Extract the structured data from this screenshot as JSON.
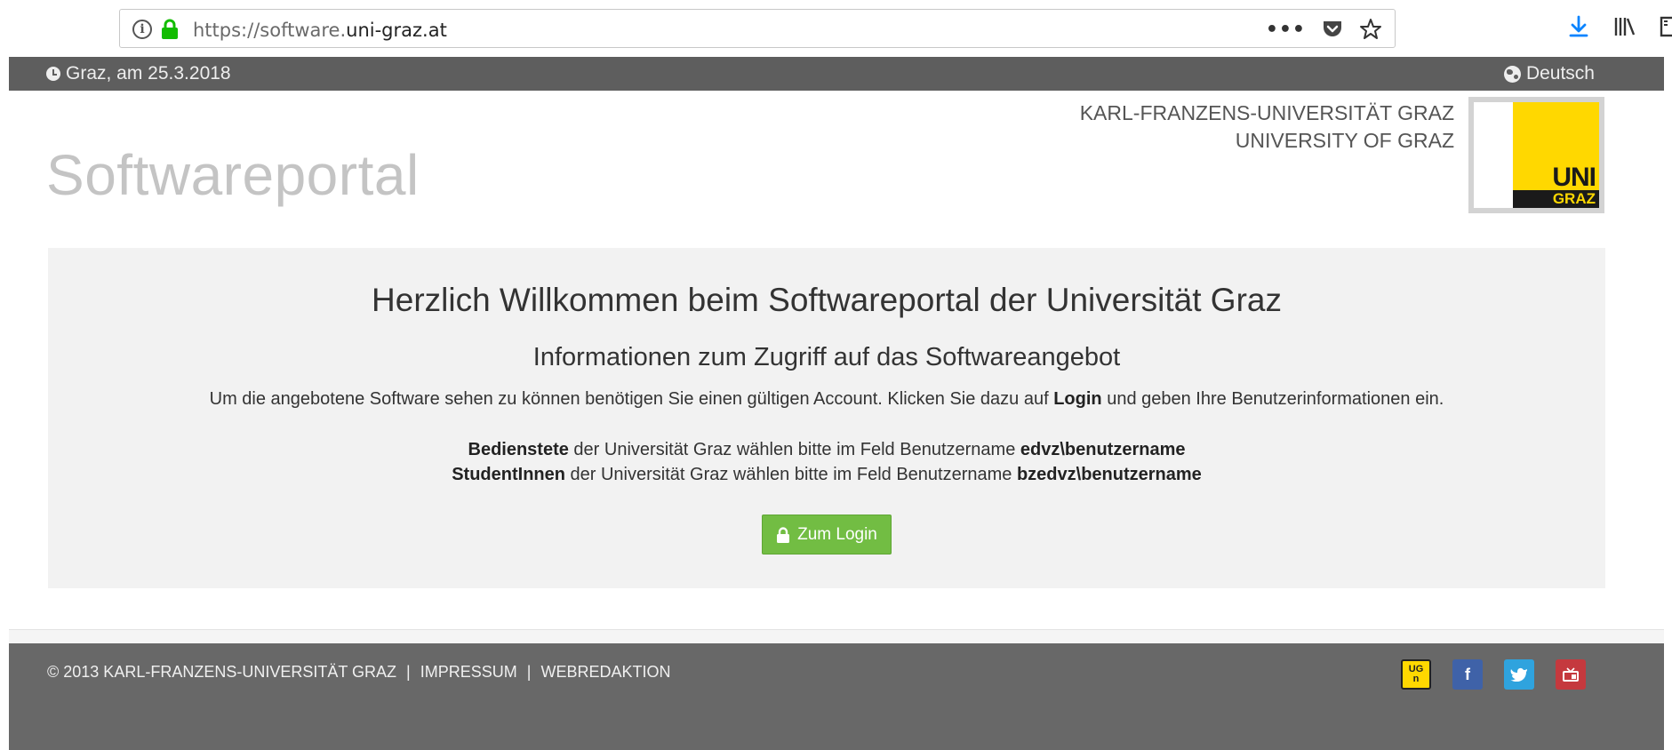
{
  "browser": {
    "url_prefix": "https://software.",
    "url_domain": "uni-graz.at",
    "page_actions_label": "•••"
  },
  "topbar": {
    "date": "Graz, am 25.3.2018",
    "language": "Deutsch"
  },
  "header": {
    "title": "Softwareportal",
    "uni_name_de": "KARL-FRANZENS-UNIVERSITÄT GRAZ",
    "uni_name_en": "UNIVERSITY OF GRAZ",
    "logo_top": "UNI",
    "logo_bottom": "GRAZ"
  },
  "main": {
    "heading": "Herzlich Willkommen beim Softwareportal der Universität Graz",
    "subheading": "Informationen zum Zugriff auf das Softwareangebot",
    "intro_before": "Um die angebotene Software sehen zu können benötigen Sie einen gültigen Account. Klicken Sie dazu auf ",
    "intro_bold": "Login",
    "intro_after": " und geben Ihre Benutzerinformationen ein.",
    "staff_bold": "Bedienstete",
    "staff_text": " der Universität Graz wählen bitte im Feld Benutzername ",
    "staff_user": "edvz\\benutzername",
    "student_bold": "StudentInnen",
    "student_text": " der Universität Graz wählen bitte im Feld Benutzername ",
    "student_user": "bzedvz\\benutzername",
    "login_button": "Zum Login"
  },
  "footer": {
    "copyright": "© 2013 KARL-FRANZENS-UNIVERSITÄT GRAZ",
    "separator": "|",
    "impressum": "IMPRESSUM",
    "webredaktion": "WEBREDAKTION",
    "social": {
      "ug_top": "UG",
      "ug_bottom": "n",
      "facebook": "f"
    }
  },
  "colors": {
    "accent_green": "#72bd43",
    "topbar_grey": "#5e5e5e",
    "footer_grey": "#686868",
    "logo_yellow": "#ffd800"
  }
}
